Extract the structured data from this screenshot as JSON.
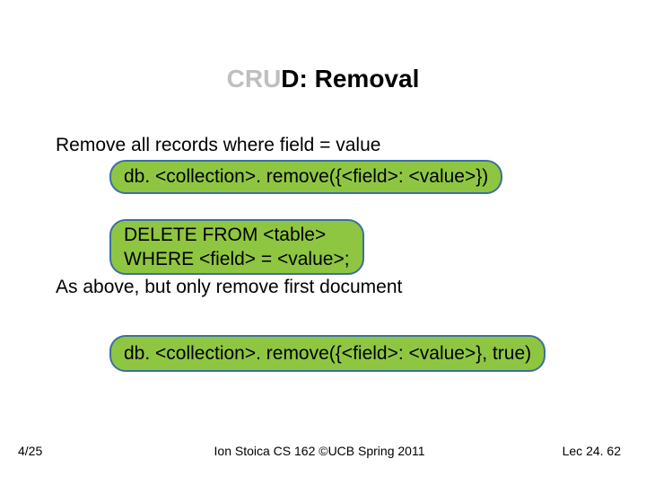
{
  "title": {
    "prefix_faded": "CRU",
    "prefix_dark": "D",
    "rest": ": Removal"
  },
  "body": {
    "desc1": "Remove all records where field = value",
    "code1": "db. <collection>. remove({<field>: <value>})",
    "sql_line1": "DELETE FROM <table>",
    "sql_line2": "WHERE <field> = <value>;",
    "desc2": "As above, but only remove first document",
    "code2": "db. <collection>. remove({<field>: <value>}, true)"
  },
  "footer": {
    "date": "4/25",
    "center": "Ion Stoica CS 162 ©UCB Spring 2011",
    "lec": "Lec 24. 62"
  }
}
